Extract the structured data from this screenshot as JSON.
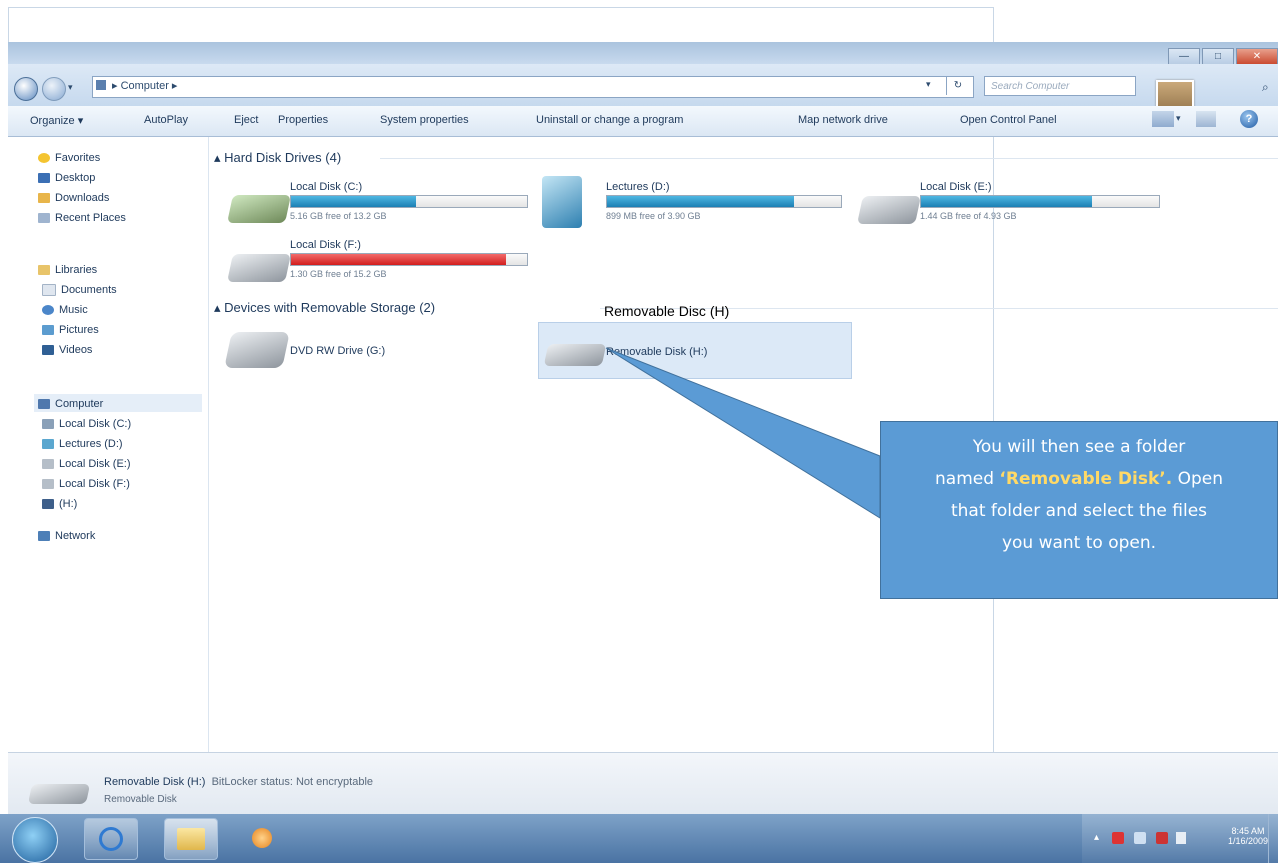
{
  "window": {
    "address": "Computer",
    "search_placeholder": "Search Computer",
    "minimize": "—",
    "maximize": "□",
    "close": "✕"
  },
  "toolbar": {
    "items": [
      "Organize ▾",
      "AutoPlay",
      "Eject",
      "Properties",
      "System properties",
      "Uninstall or change a program",
      "Map network drive",
      "Open Control Panel"
    ]
  },
  "nav": {
    "favorites": "Favorites",
    "desktop": "Desktop",
    "downloads": "Downloads",
    "recent": "Recent Places",
    "libraries": "Libraries",
    "documents": "Documents",
    "music": "Music",
    "pictures": "Pictures",
    "videos": "Videos",
    "computer": "Computer",
    "c": "Local Disk (C:)",
    "d": "Lectures (D:)",
    "e": "Local Disk (E:)",
    "f": "Local Disk (F:)",
    "h": "(H:)",
    "network": "Network"
  },
  "groups": {
    "hdd": "Hard Disk Drives (4)",
    "removable": "Devices with Removable Storage (2)"
  },
  "drives": {
    "c": {
      "name": "Local Disk (C:)",
      "free": "5.16 GB free of 13.2 GB",
      "used_fraction": 0.53
    },
    "d": {
      "name": "Lectures (D:)",
      "free": "899 MB free of 3.90 GB",
      "used_fraction": 0.8
    },
    "e": {
      "name": "Local Disk (E:)",
      "free": "1.44 GB free of 4.93 GB",
      "used_fraction": 0.72
    },
    "f": {
      "name": "Local Disk (F:)",
      "free": "1.30 GB free of 15.2 GB",
      "used_fraction": 0.91
    },
    "g": {
      "name": "DVD RW Drive (G:)"
    },
    "h": {
      "name": "Removable Disk (H:)"
    }
  },
  "details": {
    "title": "Removable Disk (H:)",
    "bitlocker": "BitLocker status: Not encryptable",
    "type": "Removable Disk"
  },
  "clock": {
    "time": "8:45 AM",
    "date": "1/16/2009"
  },
  "callout": {
    "title": "Removable Disc (H)",
    "line1": "You will then see a folder",
    "named": "named ",
    "highlight": "‘Removable Disk’.",
    "open": " Open",
    "line3": "that folder and select the files",
    "line4": "you want to open."
  }
}
